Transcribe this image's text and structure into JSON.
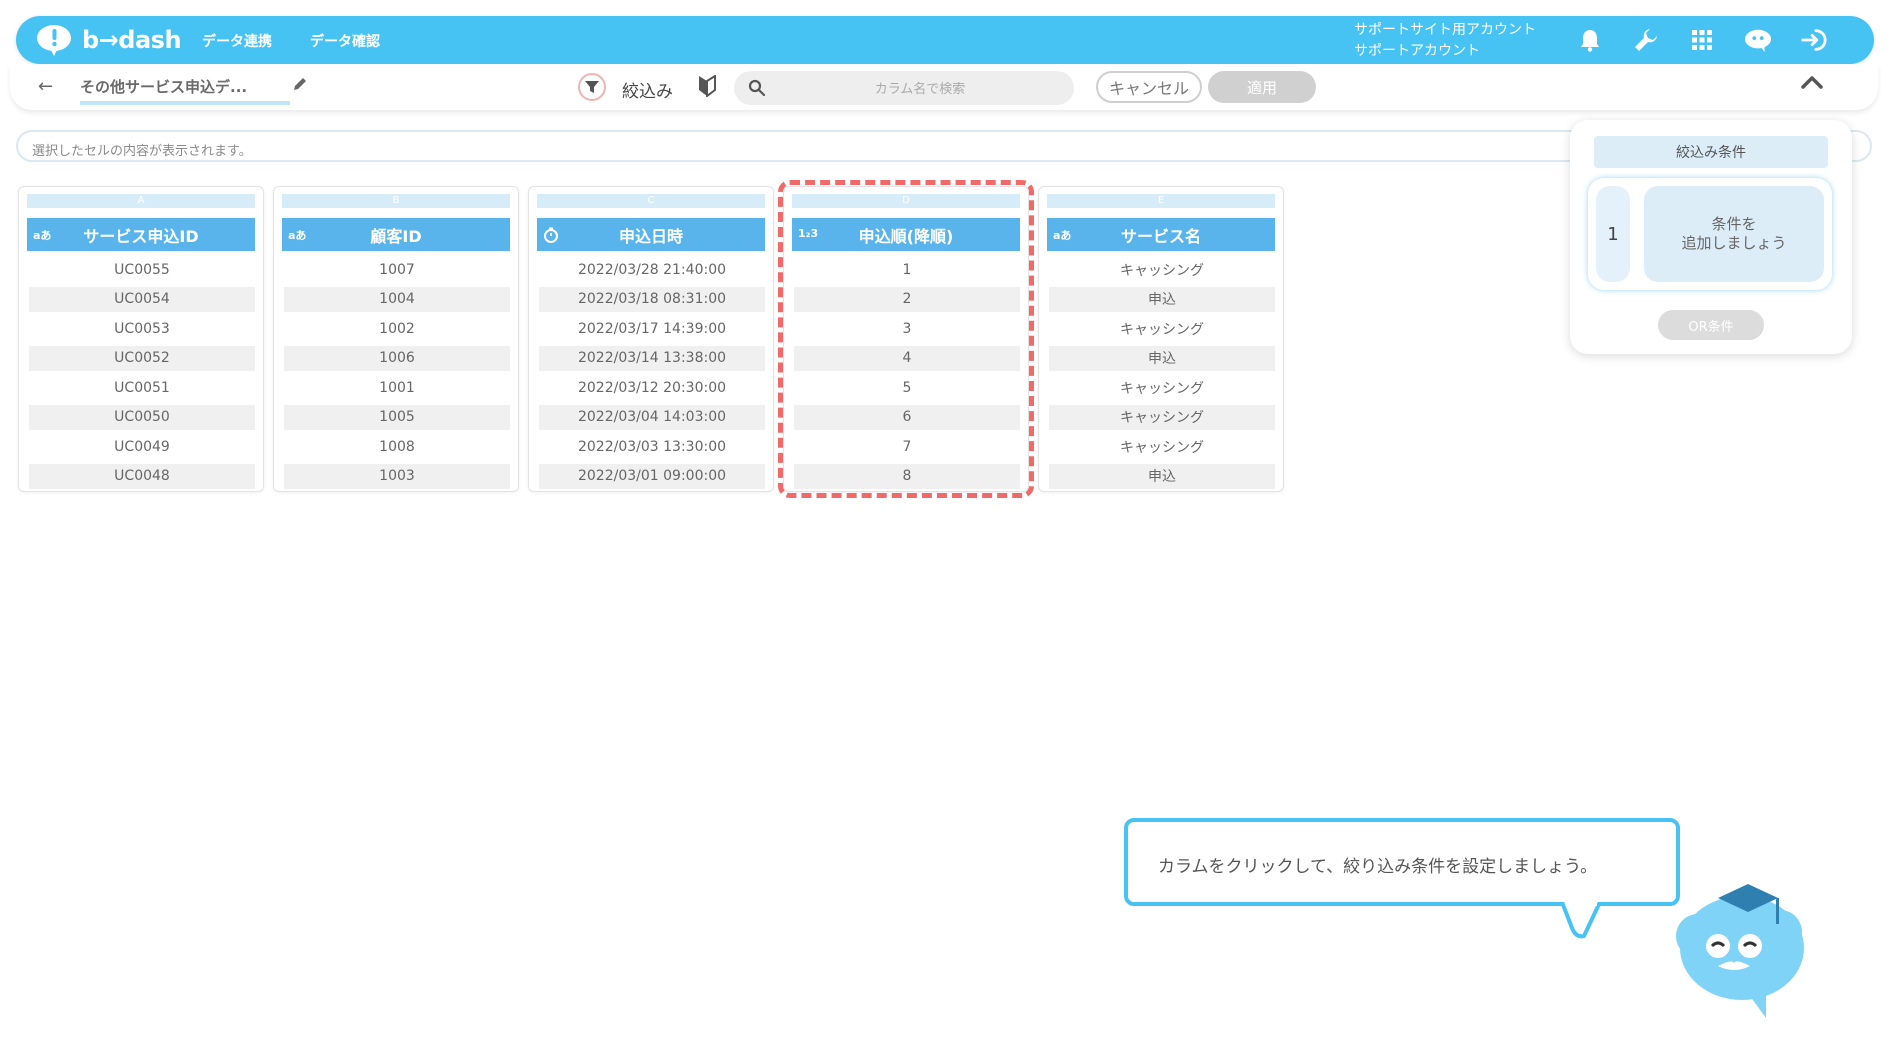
{
  "app": {
    "name": "b→dash"
  },
  "nav": {
    "items": [
      "データ連携",
      "データ確認"
    ]
  },
  "account": {
    "line1": "サポートサイト用アカウント",
    "line2": "サポートアカウント"
  },
  "icons": [
    "bell-icon",
    "wrench-icon",
    "grid-icon",
    "chat-mascot-icon",
    "logout-icon"
  ],
  "toolbar": {
    "sheet_title": "その他サービス申込デ...",
    "filter_label": "絞込み",
    "search_placeholder": "カラム名で検索",
    "cancel_label": "キャンセル",
    "apply_label": "適用"
  },
  "cellbar": {
    "placeholder": "選択したセルの内容が表示されます。"
  },
  "columns": [
    {
      "letter": "A",
      "type": "aあ",
      "header": "サービス申込ID",
      "rows": [
        "UC0055",
        "UC0054",
        "UC0053",
        "UC0052",
        "UC0051",
        "UC0050",
        "UC0049",
        "UC0048"
      ]
    },
    {
      "letter": "B",
      "type": "aあ",
      "header": "顧客ID",
      "rows": [
        "1007",
        "1004",
        "1002",
        "1006",
        "1001",
        "1005",
        "1008",
        "1003"
      ]
    },
    {
      "letter": "C",
      "type": "clock",
      "header": "申込日時",
      "rows": [
        "2022/03/28 21:40:00",
        "2022/03/18 08:31:00",
        "2022/03/17 14:39:00",
        "2022/03/14 13:38:00",
        "2022/03/12 20:30:00",
        "2022/03/04 14:03:00",
        "2022/03/03 13:30:00",
        "2022/03/01 09:00:00"
      ]
    },
    {
      "letter": "D",
      "type": "1₂3",
      "header": "申込順(降順)",
      "rows": [
        "1",
        "2",
        "3",
        "4",
        "5",
        "6",
        "7",
        "8"
      ]
    },
    {
      "letter": "E",
      "type": "aあ",
      "header": "サービス名",
      "rows": [
        "キャッシング",
        "申込",
        "キャッシング",
        "申込",
        "キャッシング",
        "キャッシング",
        "キャッシング",
        "申込"
      ]
    }
  ],
  "filter_panel": {
    "title": "絞込み条件",
    "condition_number": "1",
    "add_line1": "条件を",
    "add_line2": "追加しましょう",
    "or_label": "OR条件"
  },
  "tooltip": {
    "text": "カラムをクリックして、絞り込み条件を設定しましょう。"
  },
  "colors": {
    "accent": "#47c3f3",
    "header": "#5ab4ec",
    "highlight": "#f06a6a"
  }
}
